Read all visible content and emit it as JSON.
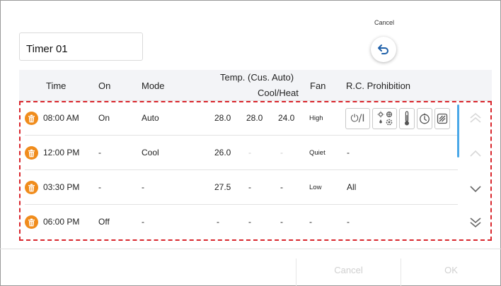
{
  "timer_name": "Timer 01",
  "cancel_top_label": "Cancel",
  "header": {
    "time": "Time",
    "on": "On",
    "mode": "Mode",
    "temp_line1": "Temp. (Cus. Auto)",
    "temp_line2": "Cool/Heat",
    "fan": "Fan",
    "rc_prohibition": "R.C. Prohibition"
  },
  "rows": [
    {
      "time": "08:00 AM",
      "on": "On",
      "mode": "Auto",
      "temp": "28.0",
      "cool": "28.0",
      "heat": "24.0",
      "fan": "High",
      "rc": ""
    },
    {
      "time": "12:00 PM",
      "on": "-",
      "mode": "Cool",
      "temp": "26.0",
      "cool": "-",
      "heat": "-",
      "fan": "Quiet",
      "rc": "-"
    },
    {
      "time": "03:30 PM",
      "on": "-",
      "mode": "-",
      "temp": "27.5",
      "cool": "-",
      "heat": "-",
      "fan": "Low",
      "rc": "All"
    },
    {
      "time": "06:00 PM",
      "on": "Off",
      "mode": "-",
      "temp": "-",
      "cool": "-",
      "heat": "-",
      "fan": "-",
      "rc": "-"
    }
  ],
  "prohibition_icons": {
    "on_off": "⏻/I"
  },
  "footer": {
    "cancel": "Cancel",
    "ok": "OK"
  },
  "colors": {
    "delete_icon": "#f08c1c",
    "selection_border": "#d9262c",
    "scrollbar": "#4aa8e8"
  }
}
